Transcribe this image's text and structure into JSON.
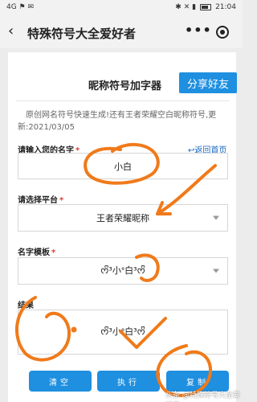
{
  "status": {
    "time": "21:04",
    "left_icons": "4G ⚑ ✉",
    "right_icons": "✱ ✕ ▮"
  },
  "nav": {
    "title": "特殊符号大全爱好者",
    "back_glyph": "‹",
    "more_glyph": "•••"
  },
  "header": {
    "title": "昵称符号加字器",
    "share_label": "分享好友"
  },
  "description": "原创网名符号快速生成!还有王者荣耀空白昵称符号,更新:2021/03/05",
  "form": {
    "name": {
      "label": "请输入您的名字",
      "star": "*",
      "value": "小白"
    },
    "home_link": "↩返回首页",
    "platform": {
      "label": "请选择平台",
      "star": "*",
      "value": "王者荣耀昵称"
    },
    "template": {
      "label": "名字模板",
      "star": "*",
      "value": "ᰔᩚ³小ᐤ白³ᰔᩚ"
    },
    "result": {
      "label": "结果",
      "value": "ᰔᩚ³小ᐤ白³ᰔᩚ"
    }
  },
  "buttons": {
    "clear": "清空",
    "run": "执行",
    "copy": "复制"
  },
  "watermark": "头条 @特殊符号大全爱好者",
  "colors": {
    "accent": "#1f8fe0",
    "required": "#e53935",
    "link": "#1565c0",
    "scribble": "#f07a1a"
  }
}
